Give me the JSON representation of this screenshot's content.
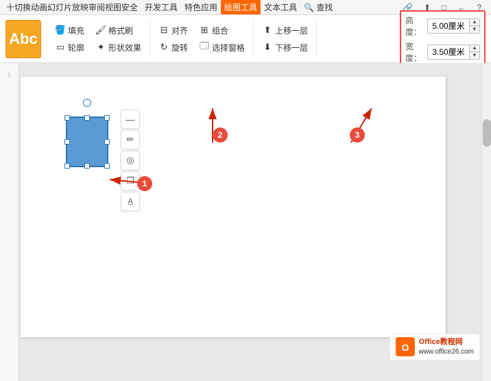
{
  "menubar": {
    "items": [
      {
        "label": "十切换动画幻灯片放映审阅视图安全",
        "active": false
      },
      {
        "label": "开发工具",
        "active": false
      },
      {
        "label": "特色应用",
        "active": false
      },
      {
        "label": "绘图工具",
        "active": true
      },
      {
        "label": "文本工具",
        "active": false
      },
      {
        "label": "查找",
        "active": false
      }
    ]
  },
  "toolbar": {
    "abc_label": "Abc",
    "fill_label": "填充",
    "outline_label": "轮廓",
    "format_brush_label": "格式刷",
    "shape_effect_label": "形状效果",
    "align_label": "对齐",
    "group_label": "组合",
    "rotate_label": "旋转",
    "select_window_label": "选择窗格",
    "move_up_label": "上移一层",
    "move_down_label": "下移一层",
    "height_label": "高度：",
    "width_label": "宽度：",
    "height_value": "5.00厘米",
    "width_value": "3.50厘米"
  },
  "annotations": [
    {
      "id": 1,
      "label": "1"
    },
    {
      "id": 2,
      "label": "2"
    },
    {
      "id": 3,
      "label": "3"
    }
  ],
  "float_toolbar": {
    "btn1": "—",
    "btn2": "✏",
    "btn3": "◎",
    "btn4": "❐",
    "btn5": "A"
  },
  "logo": {
    "site": "Office教程网",
    "url": "www.office26.com"
  },
  "canvas": {
    "shape_color": "#5b9bd5"
  }
}
